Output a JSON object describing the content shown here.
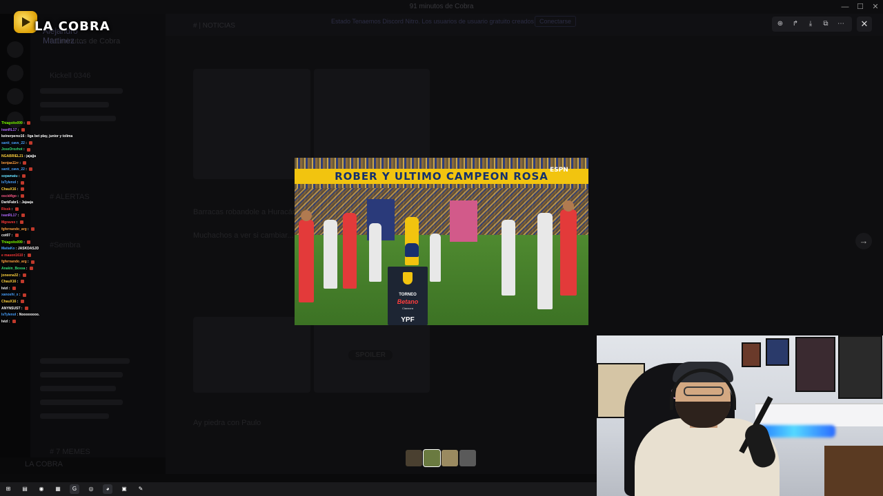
{
  "window": {
    "title": "91 minutos de Cobra",
    "controls": [
      "—",
      "☐",
      "✕"
    ]
  },
  "overlay": {
    "logo_text": "LA COBRA",
    "discord_user": "Alejandro Martinez ..."
  },
  "discord_bg": {
    "server_name": "91 minutos de Cobra",
    "channel_header": "# | NOTICIAS",
    "banner_text": "Estado Tenaemos Discord Nitro. Los usuarios de usuario gratuito creados",
    "banner_button": "Conectarse",
    "channels": [
      "Kickell 0346",
      "#Sembra",
      "# ALERTAS",
      "# 7 MEMES"
    ],
    "messages": [
      "Barracas robandole a Huracán...  Estudiantes negandole el pasillo a Central. Veron sancionado...",
      "Muchachos a ver si cambiar...",
      "Ay piedra con Paulo"
    ],
    "spoiler_label": "SPOILER",
    "user_footer": "LA COBRA"
  },
  "chat": [
    {
      "user": "Thiagoito099",
      "msg": "",
      "color": "#7cfc00"
    },
    {
      "user": "ivanRL17",
      "msg": "",
      "color": "#b36bff"
    },
    {
      "user": "keinerperez16",
      "msg": "liga bet play, junior y tolima",
      "color": "#ffffff"
    },
    {
      "user": "santi_cavs_22",
      "msg": "",
      "color": "#4aa3ff"
    },
    {
      "user": "JoseOrozhot",
      "msg": "",
      "color": "#39e07a"
    },
    {
      "user": "NGABRIEL21",
      "msg": "jajajja",
      "color": "#ffd23f"
    },
    {
      "user": "benjaa11rr",
      "msg": "",
      "color": "#ff9f40"
    },
    {
      "user": "santi_cavs_22",
      "msg": "",
      "color": "#4aa3ff"
    },
    {
      "user": "sopamatu",
      "msg": "",
      "color": "#66e0ff"
    },
    {
      "user": "IsTylenol",
      "msg": "",
      "color": "#4aa3ff"
    },
    {
      "user": "ChauX16",
      "msg": "",
      "color": "#ffd23f"
    },
    {
      "user": "oscid4go",
      "msg": "",
      "color": "#ff5c8a"
    },
    {
      "user": "DarkFabr1",
      "msg": "Jajaaja",
      "color": "#ffffff"
    },
    {
      "user": "Rissk",
      "msg": "",
      "color": "#ff3b3b"
    },
    {
      "user": "ivanRL17",
      "msg": "",
      "color": "#b36bff"
    },
    {
      "user": "Mgravex",
      "msg": "",
      "color": "#ff3b3b"
    },
    {
      "user": "fgfernando_arg",
      "msg": "",
      "color": "#ff9f40"
    },
    {
      "user": "cot07",
      "msg": "",
      "color": "#ffffff"
    },
    {
      "user": "Thiagoito099",
      "msg": "",
      "color": "#7cfc00"
    },
    {
      "user": "MatiaKo",
      "msg": "JASKDASJD",
      "color": "#4aa3ff"
    },
    {
      "user": "e mason1610",
      "msg": "",
      "color": "#ff3b3b"
    },
    {
      "user": "fgfernando_arg",
      "msg": "",
      "color": "#ff9f40"
    },
    {
      "user": "Anakin_Bossa",
      "msg": "",
      "color": "#39e07a"
    },
    {
      "user": "joneena32",
      "msg": "",
      "color": "#ffd23f"
    },
    {
      "user": "ChauX16",
      "msg": "",
      "color": "#ffd23f"
    },
    {
      "user": "Ivizl",
      "msg": "",
      "color": "#ffffff"
    },
    {
      "user": "xanoshi_x",
      "msg": "",
      "color": "#4aa3ff"
    },
    {
      "user": "ChauX16",
      "msg": "",
      "color": "#ffd23f"
    },
    {
      "user": "ANYNSUST",
      "msg": "",
      "color": "#ffffff"
    },
    {
      "user": "IsTylenol",
      "msg": "Noooooooo.",
      "color": "#4aa3ff"
    },
    {
      "user": "Ivizl",
      "msg": "",
      "color": "#ffffff"
    }
  ],
  "lightbox": {
    "tools": [
      {
        "name": "zoom-icon",
        "glyph": "⊕"
      },
      {
        "name": "share-icon",
        "glyph": "↱"
      },
      {
        "name": "download-icon",
        "glyph": "⤓"
      },
      {
        "name": "open-external-icon",
        "glyph": "⧉"
      },
      {
        "name": "more-icon",
        "glyph": "⋯"
      }
    ],
    "close_glyph": "✕",
    "next_glyph": "→"
  },
  "photo": {
    "banner_text": "ROBER Y ULTIMO CAMPEON ROSA",
    "broadcaster": "ESPN",
    "pole_line1": "TORNEO",
    "pole_line2": "Betano",
    "pole_line3": "Clausura",
    "pole_line4": "YPF"
  },
  "colors": {
    "accent": "#5865f2",
    "banner_yellow": "#f2c40f",
    "blue": "#13306e"
  },
  "taskbar": {
    "apps": [
      {
        "name": "windows-start-icon",
        "glyph": "⊞"
      },
      {
        "name": "file-explorer-icon",
        "glyph": "▤"
      },
      {
        "name": "chrome-icon",
        "glyph": "◉"
      },
      {
        "name": "app-grid-icon",
        "glyph": "▦"
      },
      {
        "name": "browser-icon",
        "glyph": "G"
      },
      {
        "name": "obs-icon",
        "glyph": "◎"
      },
      {
        "name": "discord-icon",
        "glyph": "◕"
      },
      {
        "name": "media-icon",
        "glyph": "▣"
      },
      {
        "name": "notes-icon",
        "glyph": "✎"
      }
    ]
  }
}
